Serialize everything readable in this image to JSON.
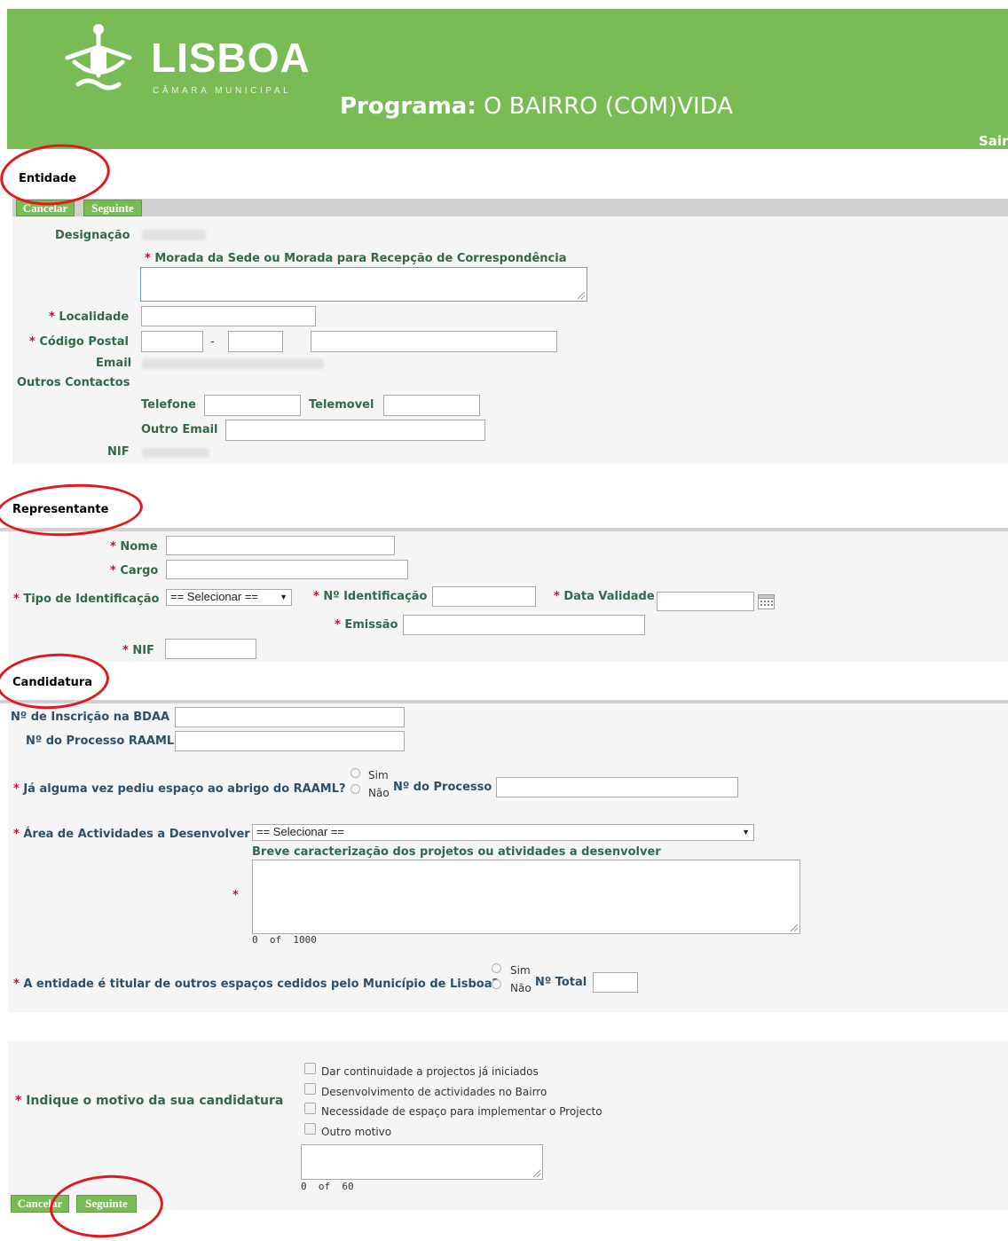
{
  "header": {
    "logo_text": "LISBOA",
    "logo_subtitle": "CÂMARA MUNICIPAL",
    "program_label": "Programa:",
    "program_name": "O BAIRRO (COM)VIDA",
    "logout_label": "Sair"
  },
  "entidade": {
    "title": "Entidade",
    "cancel_label": "Cancelar",
    "next_label": "Seguinte",
    "designacao_label": "Designação",
    "morada_label": "Morada da Sede ou Morada para Recepção de Correspondência",
    "localidade_label": "Localidade",
    "codigo_postal_label": "Código Postal",
    "postal_separator": "-",
    "email_label": "Email",
    "outros_contactos_label": "Outros Contactos",
    "telefone_label": "Telefone",
    "telemovel_label": "Telemovel",
    "outro_email_label": "Outro Email",
    "nif_label": "NIF"
  },
  "representante": {
    "title": "Representante",
    "nome_label": "Nome",
    "cargo_label": "Cargo",
    "tipo_identificacao_label": "Tipo de Identificação",
    "tipo_identificacao_value": "== Selecionar ==",
    "numero_identificacao_label": "Nº Identificação",
    "data_validade_label": "Data Validade",
    "emissao_label": "Emissão",
    "nif_label": "NIF"
  },
  "candidatura": {
    "title": "Candidatura",
    "inscricao_label": "Nº de Inscrição na BDAA",
    "processo_raaml_label": "Nº do Processo RAAML",
    "pediu_espaco_label": "Já alguma vez pediu espaço ao abrigo do RAAML?",
    "sim_label": "Sim",
    "nao_label": "Não",
    "numero_processo_label": "Nº do Processo",
    "area_actividades_label": "Área de Actividades a Desenvolver",
    "area_actividades_value": "== Selecionar ==",
    "breve_label": "Breve caracterização dos projetos ou atividades a desenvolver",
    "breve_counter": "0  of  1000",
    "titular_label": "A entidade é titular de outros espaços cedidos pelo Município de Lisboa?",
    "numero_total_label": "Nº Total"
  },
  "motivo": {
    "label": "Indique o motivo da sua candidatura",
    "options": [
      "Dar continuidade a projectos já iniciados",
      "Desenvolvimento de actividades no Bairro",
      "Necessidade de espaço para implementar o Projecto",
      "Outro motivo"
    ],
    "counter": "0  of  60"
  },
  "footer": {
    "cancel_label": "Cancelar",
    "next_label": "Seguinte"
  },
  "required_mark": "*",
  "colors": {
    "banner": "#79bc55",
    "label_green": "#31694a",
    "required_red": "#c8102e",
    "annotation_red": "#e3171c"
  }
}
